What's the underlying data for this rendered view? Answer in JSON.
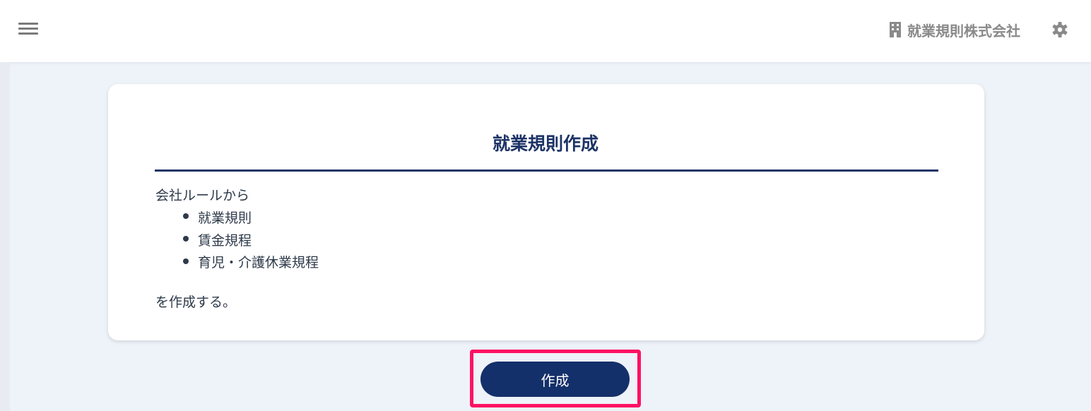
{
  "header": {
    "menu_icon": "hamburger-menu-icon",
    "company_icon": "building-icon",
    "company_name": "就業規則株式会社",
    "settings_icon": "gear-icon"
  },
  "card": {
    "title": "就業規則作成",
    "intro": "会社ルールから",
    "items": [
      "就業規則",
      "賃金規程",
      "育児・介護休業規程"
    ],
    "outro": "を作成する。"
  },
  "actions": {
    "create_label": "作成"
  },
  "colors": {
    "primary": "#14306a",
    "title": "#1d3366",
    "highlight": "#ff1063",
    "background": "#eef2f9"
  }
}
